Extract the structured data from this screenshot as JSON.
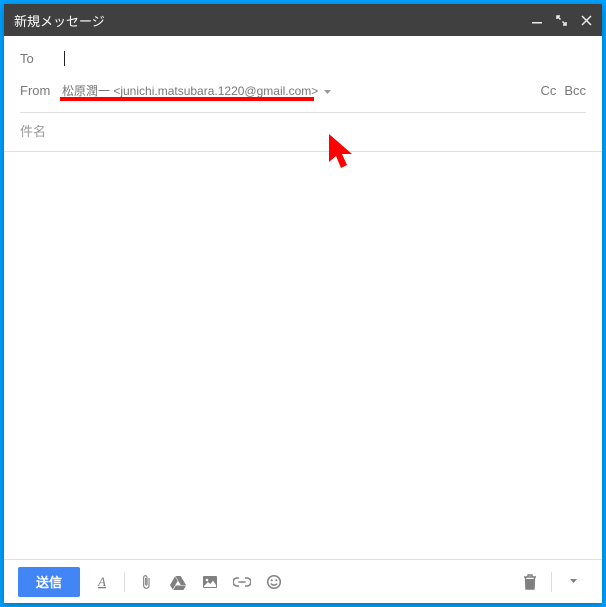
{
  "titlebar": {
    "title": "新規メッセージ"
  },
  "fields": {
    "to_label": "To",
    "to_value": "",
    "from_label": "From",
    "from_value": "松原潤一 <junichi.matsubara.1220@gmail.com>",
    "cc_label": "Cc",
    "bcc_label": "Bcc"
  },
  "subject": {
    "placeholder": "件名",
    "value": ""
  },
  "body": {
    "value": ""
  },
  "toolbar": {
    "send_label": "送信"
  },
  "colors": {
    "accent": "#4285f4",
    "annotation": "#ff0000",
    "titlebar": "#404040"
  }
}
